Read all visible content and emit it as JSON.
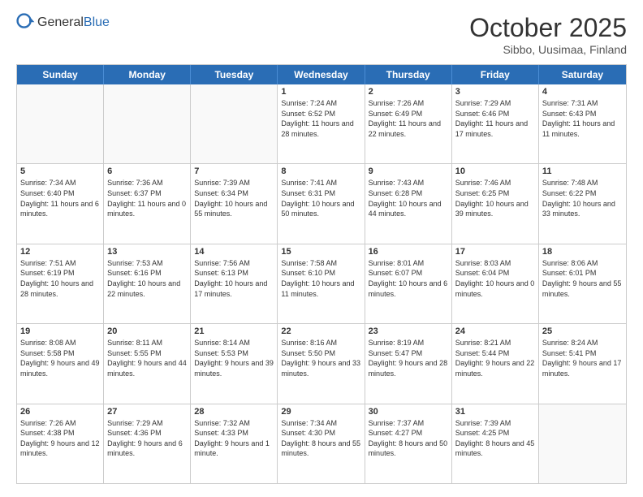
{
  "header": {
    "logo_general": "General",
    "logo_blue": "Blue",
    "month_title": "October 2025",
    "location": "Sibbo, Uusimaa, Finland"
  },
  "day_headers": [
    "Sunday",
    "Monday",
    "Tuesday",
    "Wednesday",
    "Thursday",
    "Friday",
    "Saturday"
  ],
  "weeks": [
    [
      {
        "day": "",
        "empty": true
      },
      {
        "day": "",
        "empty": true
      },
      {
        "day": "",
        "empty": true
      },
      {
        "day": "1",
        "sunrise": "7:24 AM",
        "sunset": "6:52 PM",
        "daylight": "11 hours and 28 minutes."
      },
      {
        "day": "2",
        "sunrise": "7:26 AM",
        "sunset": "6:49 PM",
        "daylight": "11 hours and 22 minutes."
      },
      {
        "day": "3",
        "sunrise": "7:29 AM",
        "sunset": "6:46 PM",
        "daylight": "11 hours and 17 minutes."
      },
      {
        "day": "4",
        "sunrise": "7:31 AM",
        "sunset": "6:43 PM",
        "daylight": "11 hours and 11 minutes."
      }
    ],
    [
      {
        "day": "5",
        "sunrise": "7:34 AM",
        "sunset": "6:40 PM",
        "daylight": "11 hours and 6 minutes."
      },
      {
        "day": "6",
        "sunrise": "7:36 AM",
        "sunset": "6:37 PM",
        "daylight": "11 hours and 0 minutes."
      },
      {
        "day": "7",
        "sunrise": "7:39 AM",
        "sunset": "6:34 PM",
        "daylight": "10 hours and 55 minutes."
      },
      {
        "day": "8",
        "sunrise": "7:41 AM",
        "sunset": "6:31 PM",
        "daylight": "10 hours and 50 minutes."
      },
      {
        "day": "9",
        "sunrise": "7:43 AM",
        "sunset": "6:28 PM",
        "daylight": "10 hours and 44 minutes."
      },
      {
        "day": "10",
        "sunrise": "7:46 AM",
        "sunset": "6:25 PM",
        "daylight": "10 hours and 39 minutes."
      },
      {
        "day": "11",
        "sunrise": "7:48 AM",
        "sunset": "6:22 PM",
        "daylight": "10 hours and 33 minutes."
      }
    ],
    [
      {
        "day": "12",
        "sunrise": "7:51 AM",
        "sunset": "6:19 PM",
        "daylight": "10 hours and 28 minutes."
      },
      {
        "day": "13",
        "sunrise": "7:53 AM",
        "sunset": "6:16 PM",
        "daylight": "10 hours and 22 minutes."
      },
      {
        "day": "14",
        "sunrise": "7:56 AM",
        "sunset": "6:13 PM",
        "daylight": "10 hours and 17 minutes."
      },
      {
        "day": "15",
        "sunrise": "7:58 AM",
        "sunset": "6:10 PM",
        "daylight": "10 hours and 11 minutes."
      },
      {
        "day": "16",
        "sunrise": "8:01 AM",
        "sunset": "6:07 PM",
        "daylight": "10 hours and 6 minutes."
      },
      {
        "day": "17",
        "sunrise": "8:03 AM",
        "sunset": "6:04 PM",
        "daylight": "10 hours and 0 minutes."
      },
      {
        "day": "18",
        "sunrise": "8:06 AM",
        "sunset": "6:01 PM",
        "daylight": "9 hours and 55 minutes."
      }
    ],
    [
      {
        "day": "19",
        "sunrise": "8:08 AM",
        "sunset": "5:58 PM",
        "daylight": "9 hours and 49 minutes."
      },
      {
        "day": "20",
        "sunrise": "8:11 AM",
        "sunset": "5:55 PM",
        "daylight": "9 hours and 44 minutes."
      },
      {
        "day": "21",
        "sunrise": "8:14 AM",
        "sunset": "5:53 PM",
        "daylight": "9 hours and 39 minutes."
      },
      {
        "day": "22",
        "sunrise": "8:16 AM",
        "sunset": "5:50 PM",
        "daylight": "9 hours and 33 minutes."
      },
      {
        "day": "23",
        "sunrise": "8:19 AM",
        "sunset": "5:47 PM",
        "daylight": "9 hours and 28 minutes."
      },
      {
        "day": "24",
        "sunrise": "8:21 AM",
        "sunset": "5:44 PM",
        "daylight": "9 hours and 22 minutes."
      },
      {
        "day": "25",
        "sunrise": "8:24 AM",
        "sunset": "5:41 PM",
        "daylight": "9 hours and 17 minutes."
      }
    ],
    [
      {
        "day": "26",
        "sunrise": "7:26 AM",
        "sunset": "4:38 PM",
        "daylight": "9 hours and 12 minutes."
      },
      {
        "day": "27",
        "sunrise": "7:29 AM",
        "sunset": "4:36 PM",
        "daylight": "9 hours and 6 minutes."
      },
      {
        "day": "28",
        "sunrise": "7:32 AM",
        "sunset": "4:33 PM",
        "daylight": "9 hours and 1 minute."
      },
      {
        "day": "29",
        "sunrise": "7:34 AM",
        "sunset": "4:30 PM",
        "daylight": "8 hours and 55 minutes."
      },
      {
        "day": "30",
        "sunrise": "7:37 AM",
        "sunset": "4:27 PM",
        "daylight": "8 hours and 50 minutes."
      },
      {
        "day": "31",
        "sunrise": "7:39 AM",
        "sunset": "4:25 PM",
        "daylight": "8 hours and 45 minutes."
      },
      {
        "day": "",
        "empty": true
      }
    ]
  ]
}
